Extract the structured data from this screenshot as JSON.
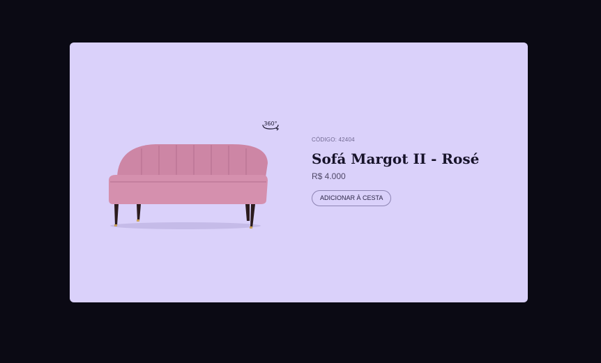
{
  "product": {
    "code_label": "CÓDIGO: 42404",
    "name": "Sofá Margot II - Rosé",
    "price": "R$ 4.000",
    "add_to_cart_label": "ADICIONAR À CESTA",
    "rotate_360_label": "360°"
  },
  "colors": {
    "page_background": "#0b0a14",
    "card_background": "#dad1fa",
    "sofa": "#d08aa8",
    "text_dark": "#17132a"
  },
  "icons": [
    "rotate-360-icon",
    "sofa-image"
  ]
}
